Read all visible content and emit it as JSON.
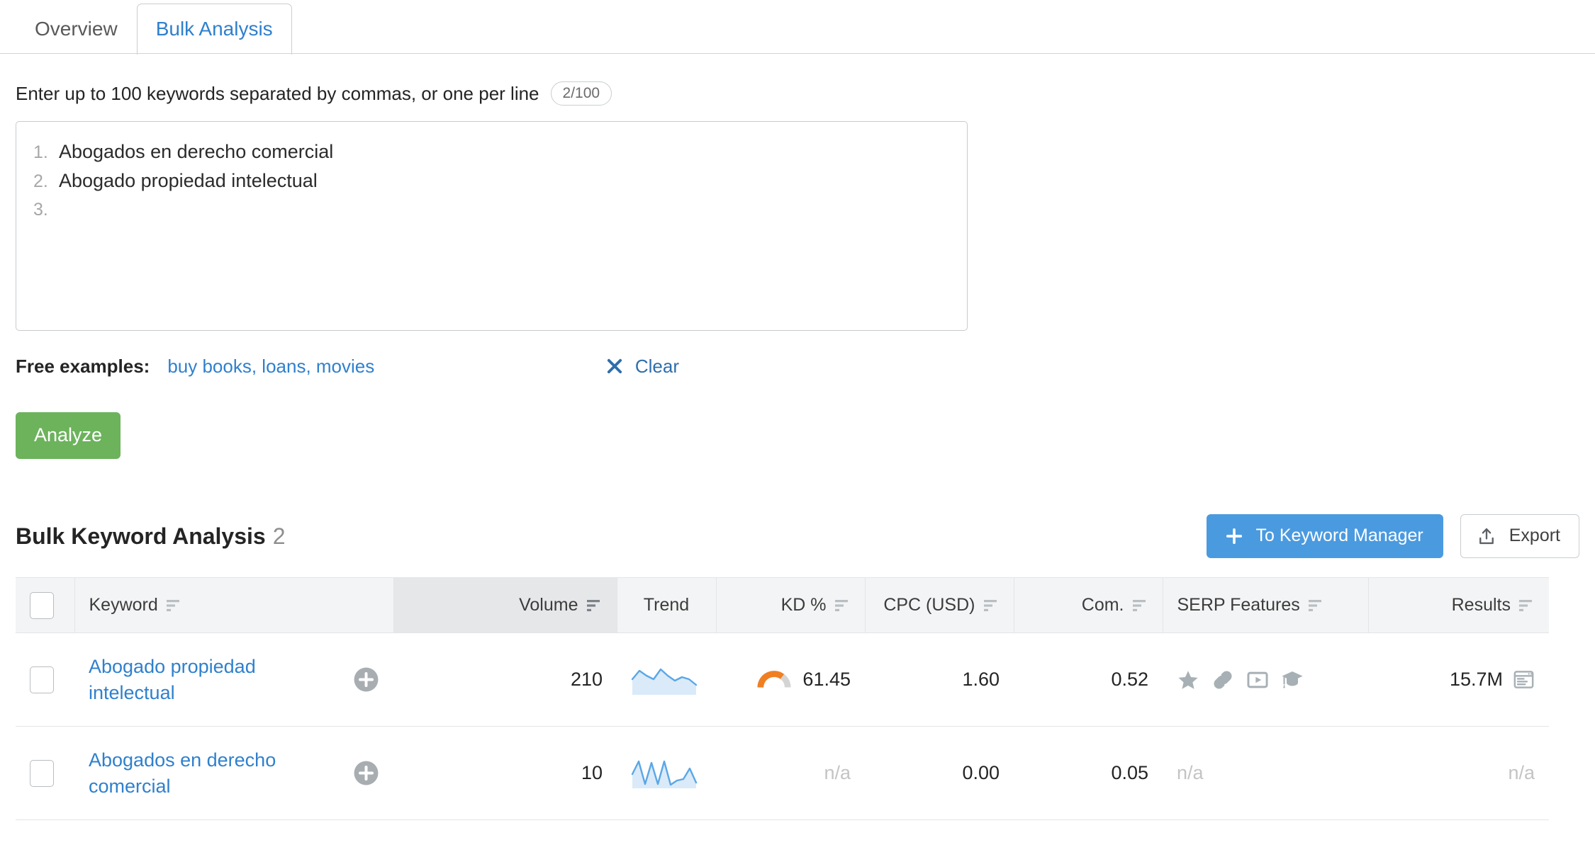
{
  "tabs": [
    {
      "label": "Overview",
      "active": false
    },
    {
      "label": "Bulk Analysis",
      "active": true
    }
  ],
  "input_section": {
    "hint": "Enter up to 100 keywords separated by commas, or one per line",
    "counter": "2/100",
    "keyword_lines": [
      {
        "num": "1.",
        "text": "Abogados en derecho comercial"
      },
      {
        "num": "2.",
        "text": "Abogado propiedad intelectual"
      },
      {
        "num": "3.",
        "text": ""
      }
    ],
    "examples_label": "Free examples:",
    "examples_links": "buy books, loans, movies",
    "clear_label": "Clear",
    "analyze_label": "Analyze"
  },
  "results": {
    "title": "Bulk Keyword Analysis",
    "count": "2",
    "to_keyword_manager_label": "To Keyword Manager",
    "export_label": "Export",
    "columns": [
      {
        "label": "Keyword",
        "sortable": true,
        "align": "left",
        "sorted": false
      },
      {
        "label": "Volume",
        "sortable": true,
        "align": "right",
        "sorted": true
      },
      {
        "label": "Trend",
        "sortable": false,
        "align": "center",
        "sorted": false
      },
      {
        "label": "KD %",
        "sortable": true,
        "align": "right",
        "sorted": false
      },
      {
        "label": "CPC (USD)",
        "sortable": true,
        "align": "right",
        "sorted": false
      },
      {
        "label": "Com.",
        "sortable": true,
        "align": "right",
        "sorted": false
      },
      {
        "label": "SERP Features",
        "sortable": true,
        "align": "left",
        "sorted": false
      },
      {
        "label": "Results",
        "sortable": true,
        "align": "right",
        "sorted": false
      }
    ],
    "rows": [
      {
        "keyword": "Abogado propiedad intelectual",
        "volume": "210",
        "trend": [
          0.55,
          0.8,
          0.62,
          0.58,
          0.88,
          0.7,
          0.52,
          0.63,
          0.58,
          0.42
        ],
        "kd": "61.45",
        "kd_value": 61.45,
        "cpc": "1.60",
        "com": "0.52",
        "serp_features": [
          "star-icon",
          "link-icon",
          "video-icon",
          "knowledge-icon"
        ],
        "results": "15.7M"
      },
      {
        "keyword": "Abogados en derecho comercial",
        "volume": "10",
        "trend": [
          0.5,
          0.95,
          0.1,
          0.88,
          0.1,
          0.95,
          0.08,
          0.3,
          0.35,
          0.72,
          0.25
        ],
        "kd": "n/a",
        "kd_value": null,
        "cpc": "0.00",
        "com": "0.05",
        "serp_features": [],
        "serp_na": "n/a",
        "results": "n/a"
      }
    ],
    "na_text": "n/a"
  },
  "colors": {
    "accent_blue": "#2f80cd",
    "button_blue": "#4a9ae0",
    "green": "#6cb35c",
    "kd_orange": "#f07f22",
    "kd_track": "#d4d4d4",
    "spark_line": "#5aa7e8",
    "spark_fill": "#dbeaf8",
    "icon_gray": "#a7b0b5"
  }
}
